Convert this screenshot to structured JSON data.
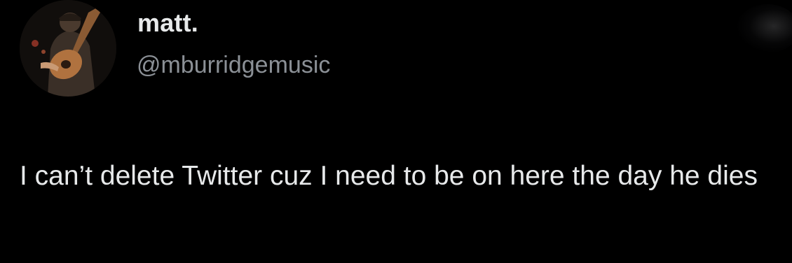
{
  "tweet": {
    "author": {
      "display_name": "matt.",
      "handle": "@mburridgemusic",
      "avatar_icon": "guitarist-photo-icon"
    },
    "text": "I can’t delete Twitter cuz I need to be on here the day he dies"
  },
  "colors": {
    "background": "#000000",
    "primary_text": "#e7e9ea",
    "secondary_text": "#8b9096"
  }
}
